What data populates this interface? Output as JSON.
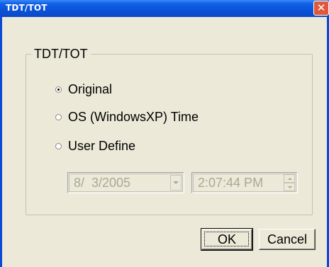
{
  "window": {
    "title": "TDT/TOT",
    "close_glyph": "✕"
  },
  "group": {
    "label": "TDT/TOT"
  },
  "options": [
    {
      "label": "Original",
      "selected": true
    },
    {
      "label": "OS (WindowsXP) Time",
      "selected": false
    },
    {
      "label": "User Define",
      "selected": false
    }
  ],
  "date_field": {
    "value": "8/  3/2005",
    "enabled": false
  },
  "time_field": {
    "value": "2:07:44 PM",
    "enabled": false
  },
  "buttons": {
    "ok": "OK",
    "cancel": "Cancel"
  },
  "colors": {
    "titlebar": "#0a52d8",
    "dialog_bg": "#ece9d8",
    "disabled_text": "#aca899",
    "close_button": "#e0583b"
  }
}
